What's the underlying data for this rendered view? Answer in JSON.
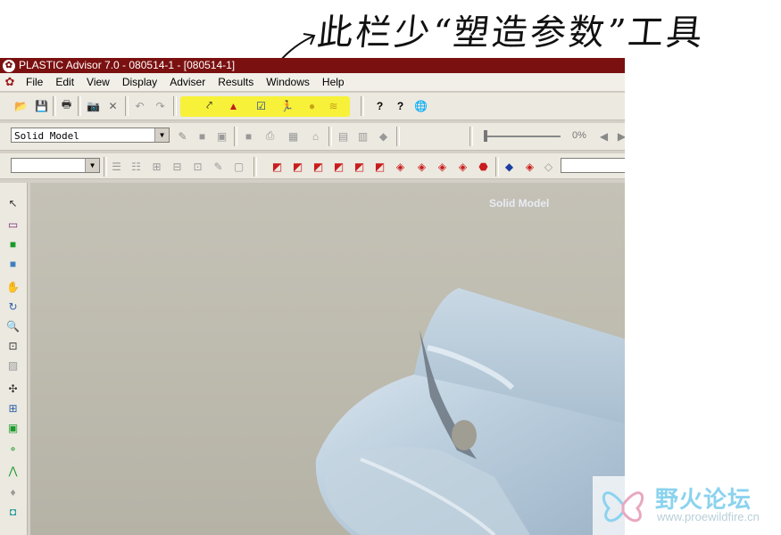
{
  "annotation": {
    "text": "此栏少“塑造参数”工具"
  },
  "window": {
    "title": "PLASTIC Advisor 7.0 - 080514-1 - [080514-1]"
  },
  "menu": {
    "items": [
      "File",
      "Edit",
      "View",
      "Display",
      "Adviser",
      "Results",
      "Windows",
      "Help"
    ]
  },
  "toolbar2": {
    "model_select": "Solid Model",
    "progress_text": "0%",
    "progress_value": 0
  },
  "viewport": {
    "label": "Solid Model"
  },
  "watermark": {
    "site_name": "野火论坛",
    "url": "www.proewildfire.cn"
  },
  "colors": {
    "titlebar": "#7b1010",
    "highlight": "#f7f239",
    "model": "#b7cbdb",
    "viewport_bg": "#c1beb2"
  }
}
